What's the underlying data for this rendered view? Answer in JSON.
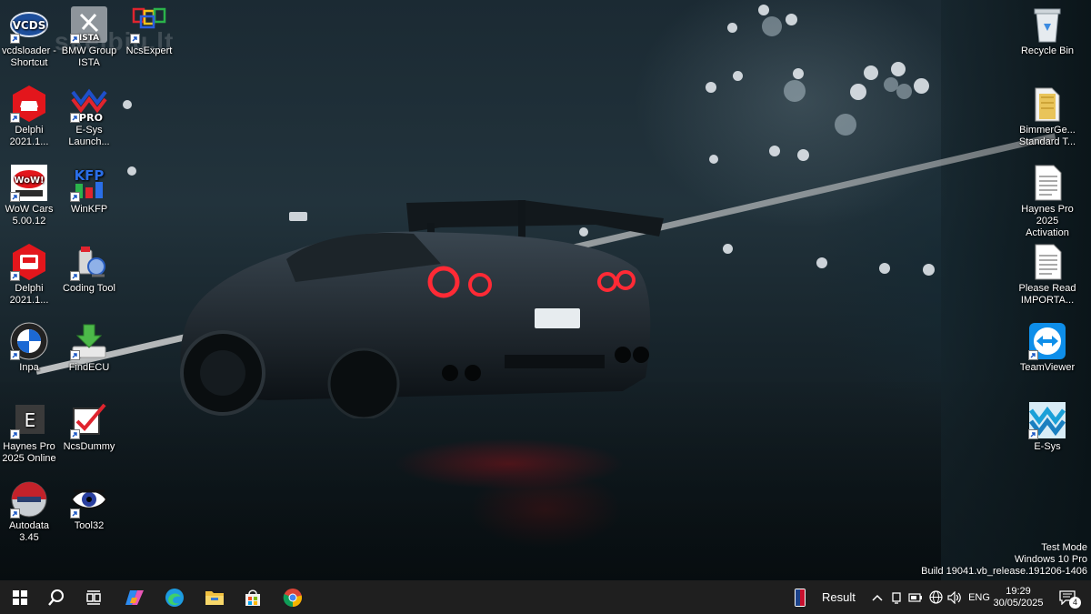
{
  "watermark": "skelbiu.lt",
  "desktop_icons_left": [
    {
      "id": "vcds",
      "label": "vcdsloader -\nShortcut",
      "icon": "vcds-icon"
    },
    {
      "id": "ista",
      "label": "BMW Group\nISTA",
      "icon": "ista-icon"
    },
    {
      "id": "ncsexpert",
      "label": "NcsExpert",
      "icon": "ncsexpert-icon"
    },
    {
      "id": "delphi1",
      "label": "Delphi\n2021.1...",
      "icon": "delphi-car-icon"
    },
    {
      "id": "esys",
      "label": "E-Sys\nLaunch...",
      "icon": "esys-pro-icon"
    },
    {
      "id": "wow",
      "label": "WoW Cars\n5.00.12",
      "icon": "wow-icon"
    },
    {
      "id": "winkfp",
      "label": "WinKFP",
      "icon": "winkfp-icon"
    },
    {
      "id": "delphi2",
      "label": "Delphi\n2021.1...",
      "icon": "delphi-truck-icon"
    },
    {
      "id": "codingtool",
      "label": "Coding Tool",
      "icon": "coding-tool-icon"
    },
    {
      "id": "inpa",
      "label": "Inpa",
      "icon": "bmw-logo-icon"
    },
    {
      "id": "findecu",
      "label": "FindECU",
      "icon": "download-arrow-icon"
    },
    {
      "id": "haynesonline",
      "label": "Haynes Pro\n2025 Online",
      "icon": "haynes-e-icon"
    },
    {
      "id": "ncsdummy",
      "label": "NcsDummy",
      "icon": "checkbox-icon"
    },
    {
      "id": "autodata",
      "label": "Autodata\n3.45",
      "icon": "autodata-icon"
    },
    {
      "id": "tool32",
      "label": "Tool32",
      "icon": "eye-icon"
    }
  ],
  "desktop_icons_right": [
    {
      "id": "recycle",
      "label": "Recycle Bin",
      "icon": "recycle-bin-icon"
    },
    {
      "id": "bimmerge",
      "label": "BimmerGe...\nStandard T...",
      "icon": "folder-icon"
    },
    {
      "id": "haynesact",
      "label": "Haynes Pro\n2025\nActivation",
      "icon": "text-file-icon"
    },
    {
      "id": "pleaseread",
      "label": "Please Read\nIMPORTA...",
      "icon": "text-file-icon"
    },
    {
      "id": "teamviewer",
      "label": "TeamViewer",
      "icon": "teamviewer-icon"
    },
    {
      "id": "esys2",
      "label": "E-Sys",
      "icon": "esys-icon"
    }
  ],
  "os_info": {
    "line1": "Test Mode",
    "line2": "Windows 10 Pro",
    "line3": "Build 19041.vb_release.191206-1406"
  },
  "taskbar": {
    "apps": [
      "start-icon",
      "search-icon",
      "task-view-icon",
      "copilot-icon",
      "edge-icon",
      "file-explorer-icon",
      "store-icon",
      "chrome-icon"
    ],
    "news_widget": "Result",
    "language": "ENG",
    "time": "19:29",
    "date": "30/05/2025",
    "notifications": "4"
  }
}
